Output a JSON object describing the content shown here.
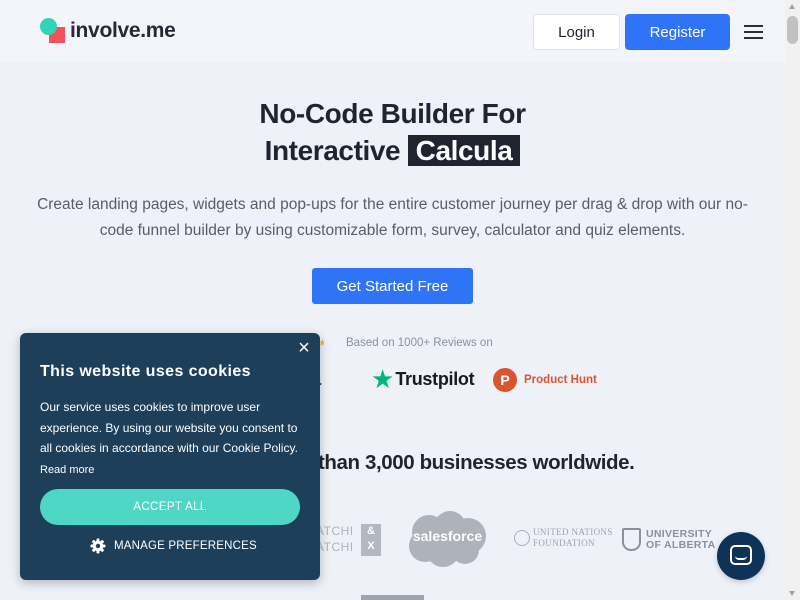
{
  "header": {
    "logo_text": "involve.me",
    "login_label": "Login",
    "register_label": "Register"
  },
  "hero": {
    "title_line1": "No-Code Builder For",
    "title_line2_prefix": "Interactive",
    "title_highlight": "Calcula",
    "subtitle": "Create landing pages, widgets and pop-ups for the entire customer journey per drag & drop with our no-code funnel builder by using customizable form, survey, calculator and quiz elements.",
    "cta_label": "Get Started Free"
  },
  "reviews": {
    "label": "Based on 1000+ Reviews on",
    "capterra_fragment": "rra",
    "trustpilot": "Trustpilot",
    "producthunt_badge": "P",
    "producthunt": "Product Hunt"
  },
  "trusted_text": "than 3,000 businesses worldwide.",
  "client_logos": {
    "ms_line1": "ATCHI",
    "ms_line2": "ATCHI",
    "ms_box_top": "&",
    "ms_box_bottom": "X",
    "salesforce": "salesforce",
    "un_line1": "UNITED NATIONS",
    "un_line2": "FOUNDATION",
    "ua_line1": "UNIVERSITY",
    "ua_line2": "OF ALBERTA"
  },
  "cookie": {
    "title": "This website uses cookies",
    "body": "Our service uses cookies to improve user experience. By using our website you consent to all cookies in accordance with our Cookie Policy.",
    "read_more": "Read more",
    "accept_label": "ACCEPT ALL",
    "manage_label": "MANAGE PREFERENCES",
    "close_glyph": "×"
  },
  "colors": {
    "brand_blue": "#2f74f6",
    "cookie_bg": "#1d3f5a",
    "accept_teal": "#4fd7c6",
    "chat_bg": "#0e3356"
  },
  "icons": [
    "menu-icon",
    "close-icon",
    "gear-icon",
    "chat-icon",
    "trustpilot-star-icon"
  ]
}
